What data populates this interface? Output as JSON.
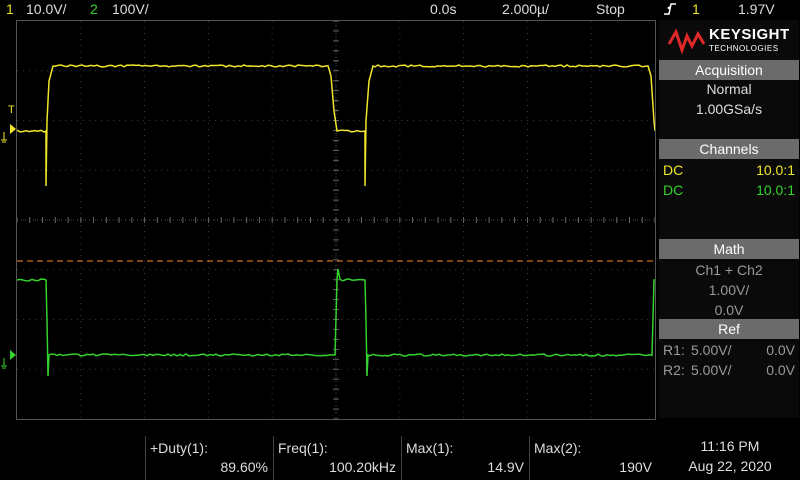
{
  "topbar": {
    "ch1_num": "1",
    "ch1_scale": "10.0V/",
    "ch2_num": "2",
    "ch2_scale": "100V/",
    "time_delay": "0.0s",
    "time_scale": "2.000µ/",
    "run_state": "Stop",
    "trigger_icon": "falling-edge",
    "trigger_source": "1",
    "trigger_level": "1.97V"
  },
  "colors": {
    "ch1": "#f0e62a",
    "ch2": "#34d22c",
    "trigger": "#ff8a1f",
    "header_bg": "#6b6b6b"
  },
  "scope_labels": {
    "ch1_marker": "1",
    "ch2_marker": "2",
    "trigger_marker": "T"
  },
  "brand": {
    "name": "KEYSIGHT",
    "sub": "TECHNOLOGIES"
  },
  "acquisition": {
    "header": "Acquisition",
    "mode": "Normal",
    "rate": "1.00GSa/s"
  },
  "channels": {
    "header": "Channels",
    "rows": [
      {
        "coupling": "DC",
        "probe": "10.0:1"
      },
      {
        "coupling": "DC",
        "probe": "10.0:1"
      }
    ]
  },
  "math": {
    "header": "Math",
    "expr": "Ch1 + Ch2",
    "scale": "1.00V/",
    "offset": "0.0V"
  },
  "ref": {
    "header": "Ref",
    "rows": [
      {
        "name": "R1:",
        "scale": "5.00V/",
        "offset": "0.0V"
      },
      {
        "name": "R2:",
        "scale": "5.00V/",
        "offset": "0.0V"
      }
    ]
  },
  "measurements": [
    {
      "label": "+Duty(1):",
      "value": "89.60%"
    },
    {
      "label": "Freq(1):",
      "value": "100.20kHz"
    },
    {
      "label": "Max(1):",
      "value": "14.9V"
    },
    {
      "label": "Max(2):",
      "value": "190V"
    }
  ],
  "clock": {
    "time": "11:16 PM",
    "date": "Aug 22, 2020"
  }
}
